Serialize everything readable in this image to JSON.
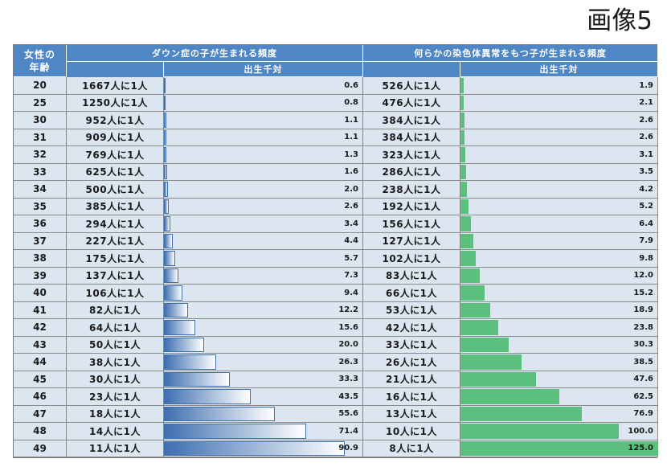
{
  "title": "画像5",
  "headers": {
    "age_line1": "女性の",
    "age_line2": "年齢",
    "downs": "ダウン症の子が生まれる頻度",
    "chromosome": "何らかの染色体異常をもつ子が生まれる頻度",
    "per_mille": "出生千対"
  },
  "colors": {
    "header": "#4f86c6",
    "row_bg": "#dce6f1",
    "blue_bar": "#3e6fb0",
    "green_bar": "#5dbf7e"
  },
  "chart_data": {
    "type": "table",
    "columns": [
      "女性の年齢",
      "ダウン症の子が生まれる頻度",
      "出生千対",
      "何らかの染色体異常をもつ子が生まれる頻度",
      "出生千対"
    ],
    "rows": [
      {
        "age": "20",
        "ds_ratio": "1667人に1人",
        "ds": 0.6,
        "ch_ratio": "526人に1人",
        "ch": 1.9
      },
      {
        "age": "25",
        "ds_ratio": "1250人に1人",
        "ds": 0.8,
        "ch_ratio": "476人に1人",
        "ch": 2.1
      },
      {
        "age": "30",
        "ds_ratio": "952人に1人",
        "ds": 1.1,
        "ch_ratio": "384人に1人",
        "ch": 2.6
      },
      {
        "age": "31",
        "ds_ratio": "909人に1人",
        "ds": 1.1,
        "ch_ratio": "384人に1人",
        "ch": 2.6
      },
      {
        "age": "32",
        "ds_ratio": "769人に1人",
        "ds": 1.3,
        "ch_ratio": "323人に1人",
        "ch": 3.1
      },
      {
        "age": "33",
        "ds_ratio": "625人に1人",
        "ds": 1.6,
        "ch_ratio": "286人に1人",
        "ch": 3.5
      },
      {
        "age": "34",
        "ds_ratio": "500人に1人",
        "ds": 2.0,
        "ch_ratio": "238人に1人",
        "ch": 4.2
      },
      {
        "age": "35",
        "ds_ratio": "385人に1人",
        "ds": 2.6,
        "ch_ratio": "192人に1人",
        "ch": 5.2
      },
      {
        "age": "36",
        "ds_ratio": "294人に1人",
        "ds": 3.4,
        "ch_ratio": "156人に1人",
        "ch": 6.4
      },
      {
        "age": "37",
        "ds_ratio": "227人に1人",
        "ds": 4.4,
        "ch_ratio": "127人に1人",
        "ch": 7.9
      },
      {
        "age": "38",
        "ds_ratio": "175人に1人",
        "ds": 5.7,
        "ch_ratio": "102人に1人",
        "ch": 9.8
      },
      {
        "age": "39",
        "ds_ratio": "137人に1人",
        "ds": 7.3,
        "ch_ratio": "83人に1人",
        "ch": 12.0
      },
      {
        "age": "40",
        "ds_ratio": "106人に1人",
        "ds": 9.4,
        "ch_ratio": "66人に1人",
        "ch": 15.2
      },
      {
        "age": "41",
        "ds_ratio": "82人に1人",
        "ds": 12.2,
        "ch_ratio": "53人に1人",
        "ch": 18.9
      },
      {
        "age": "42",
        "ds_ratio": "64人に1人",
        "ds": 15.6,
        "ch_ratio": "42人に1人",
        "ch": 23.8
      },
      {
        "age": "43",
        "ds_ratio": "50人に1人",
        "ds": 20.0,
        "ch_ratio": "33人に1人",
        "ch": 30.3
      },
      {
        "age": "44",
        "ds_ratio": "38人に1人",
        "ds": 26.3,
        "ch_ratio": "26人に1人",
        "ch": 38.5
      },
      {
        "age": "45",
        "ds_ratio": "30人に1人",
        "ds": 33.3,
        "ch_ratio": "21人に1人",
        "ch": 47.6
      },
      {
        "age": "46",
        "ds_ratio": "23人に1人",
        "ds": 43.5,
        "ch_ratio": "16人に1人",
        "ch": 62.5
      },
      {
        "age": "47",
        "ds_ratio": "18人に1人",
        "ds": 55.6,
        "ch_ratio": "13人に1人",
        "ch": 76.9
      },
      {
        "age": "48",
        "ds_ratio": "14人に1人",
        "ds": 71.4,
        "ch_ratio": "10人に1人",
        "ch": 100.0
      },
      {
        "age": "49",
        "ds_ratio": "11人に1人",
        "ds": 90.9,
        "ch_ratio": "8人に1人",
        "ch": 125.0
      }
    ]
  }
}
